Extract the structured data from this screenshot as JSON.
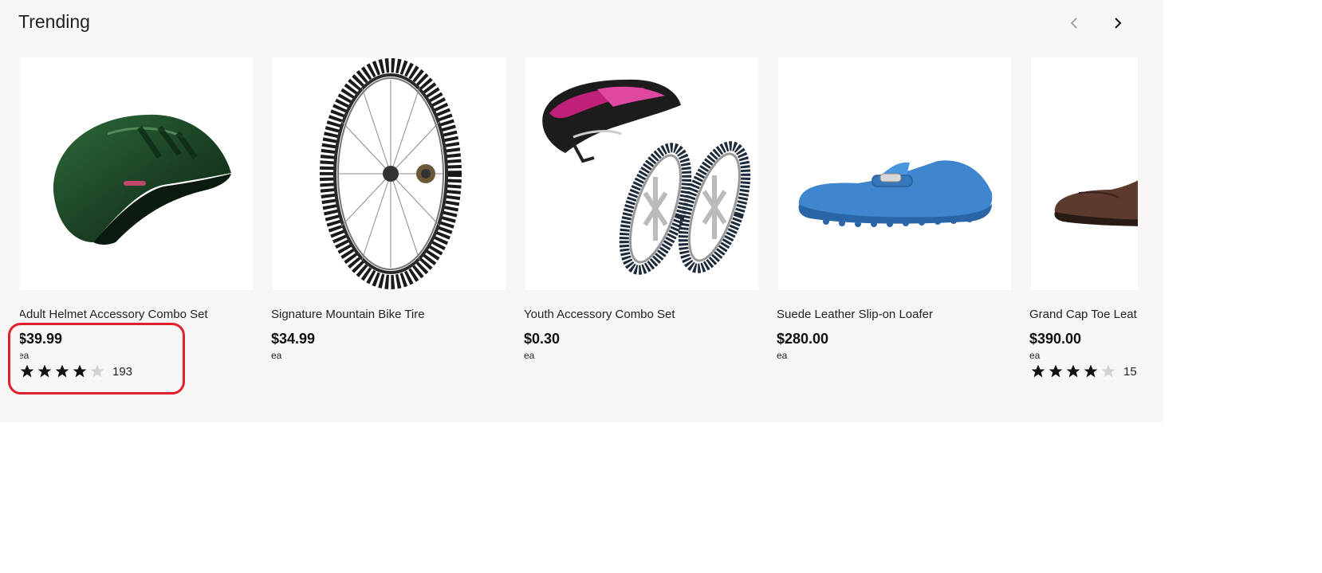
{
  "section": {
    "title": "Trending"
  },
  "carousel": {
    "prev_label": "Previous",
    "next_label": "Next"
  },
  "products": [
    {
      "name": "Adult Helmet Accessory Combo Set",
      "price": "$39.99",
      "unit": "ea",
      "rating": 4,
      "reviews": "193",
      "image": "green-helmet"
    },
    {
      "name": "Signature Mountain Bike Tire",
      "price": "$34.99",
      "unit": "ea",
      "image": "bike-wheel"
    },
    {
      "name": "Youth Accessory Combo Set",
      "price": "$0.30",
      "unit": "ea",
      "image": "helmet-and-wheels"
    },
    {
      "name": "Suede Leather Slip-on Loafer",
      "price": "$280.00",
      "unit": "ea",
      "image": "blue-loafer"
    },
    {
      "name": "Grand Cap Toe Leat",
      "price": "$390.00",
      "unit": "ea",
      "rating": 4,
      "reviews": "15",
      "image": "brown-oxford"
    }
  ],
  "colors": {
    "panel": "#f7f6f4",
    "highlight": "#e0202c",
    "star_filled": "#111111",
    "star_empty": "#d2d2d2"
  }
}
